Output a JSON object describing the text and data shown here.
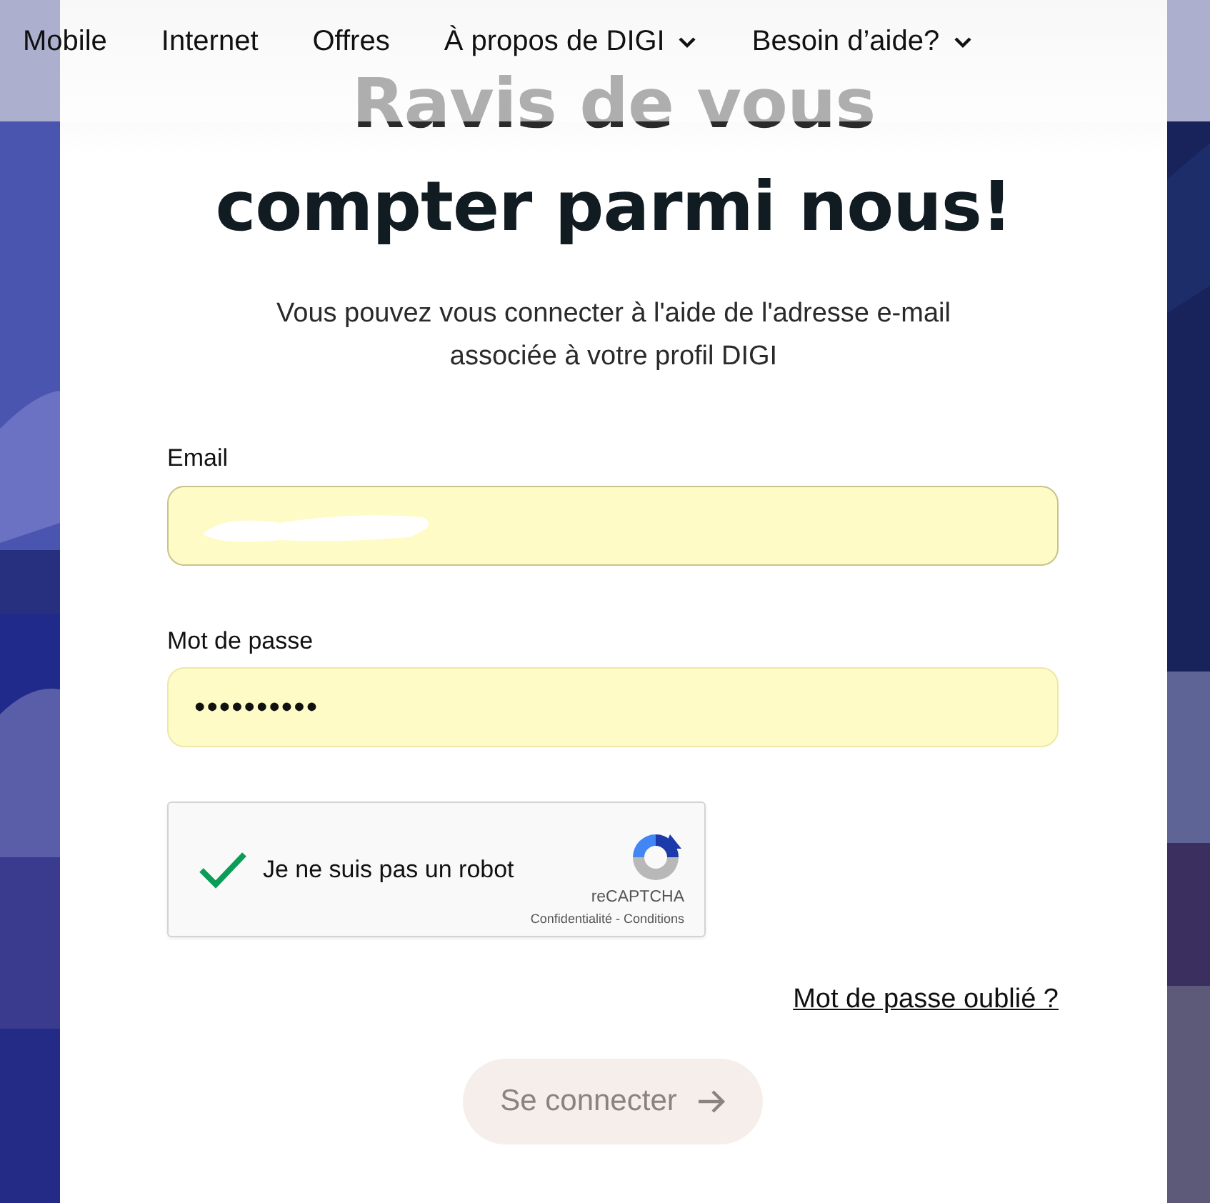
{
  "nav": [
    {
      "label": "Mobile",
      "dropdown": false
    },
    {
      "label": "Internet",
      "dropdown": false
    },
    {
      "label": "Offres",
      "dropdown": false
    },
    {
      "label": "À propos de DIGI",
      "dropdown": true
    },
    {
      "label": "Besoin d’aide?",
      "dropdown": true
    }
  ],
  "heading": [
    "Ravis de vous",
    "compter parmi nous!"
  ],
  "intro": [
    "Vous pouvez vous connecter à l'aide de l'adresse e-mail",
    "associée à votre profil DIGI"
  ],
  "fields": [
    {
      "label": "Email",
      "kind": "redacted"
    },
    {
      "label": "Mot de passe",
      "kind": "password",
      "value": "••••••••••"
    }
  ],
  "captcha": {
    "label": "Je ne suis pas un robot",
    "checked": true,
    "brand": "reCAPTCHA",
    "privacy": "Confidentialité",
    "separator": "-",
    "terms": "Conditions"
  },
  "forgot_link": "Mot de passe oublié ?",
  "submit": {
    "label": "Se connecter",
    "disabled": true
  }
}
